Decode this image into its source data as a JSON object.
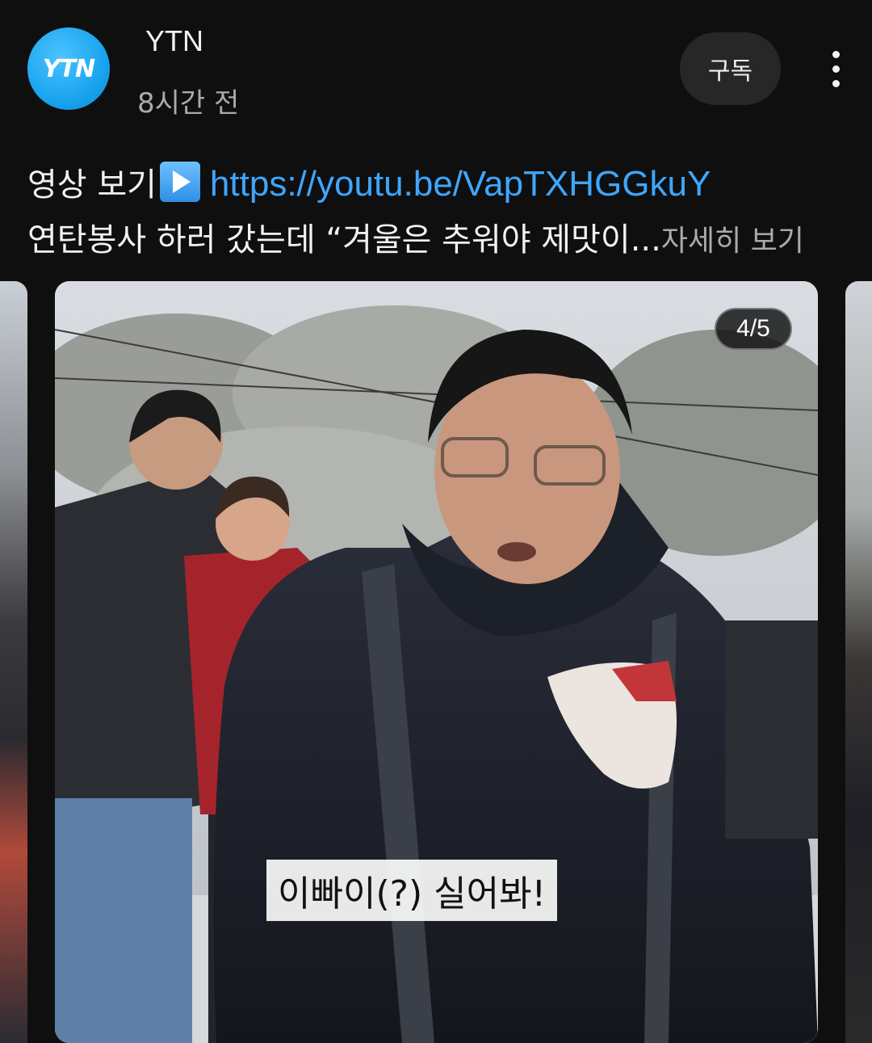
{
  "channel": {
    "avatar_text": "YTN",
    "name": "YTN",
    "time_ago": "8시간 전",
    "subscribe_label": "구독",
    "brand_color": "#1aa4ef"
  },
  "post": {
    "line1_prefix": "영상 보기",
    "play_icon": "play-button-emoji",
    "link_text": "https://youtu.be/VapTXHGGkuY",
    "line2_text": "연탄봉사 하러 갔는데 “겨울은 추워야 제맛이...",
    "see_more_label": "자세히 보기",
    "link_color": "#3ea6ff"
  },
  "carousel": {
    "counter": "4/5",
    "caption": "이빠이(?) 실어봐!"
  },
  "icons": {
    "more": "more-vertical-icon"
  }
}
